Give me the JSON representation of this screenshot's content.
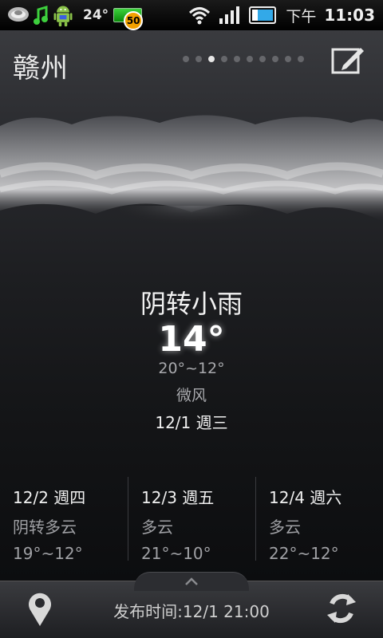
{
  "status_bar": {
    "temperature": "24°",
    "battery_badge": "50",
    "time_period": "下午",
    "time": "11:03",
    "icons": [
      "weather-clouds-icon",
      "music-note-icon",
      "android-icon",
      "battery-icon",
      "wifi-icon",
      "signal-icon",
      "battery-level-icon"
    ]
  },
  "header": {
    "city": "赣州",
    "page_count": 10,
    "active_page": 3,
    "edit_icon": "edit-icon"
  },
  "current": {
    "condition": "阴转小雨",
    "temperature": "14°",
    "range": "20°~12°",
    "wind": "微风",
    "date": "12/1 週三"
  },
  "forecast": [
    {
      "date": "12/2 週四",
      "condition": "阴转多云",
      "range": "19°~12°"
    },
    {
      "date": "12/3 週五",
      "condition": "多云",
      "range": "21°~10°"
    },
    {
      "date": "12/4 週六",
      "condition": "多云",
      "range": "22°~12°"
    }
  ],
  "bottom_bar": {
    "publish_time": "发布时间:12/1 21:00",
    "location_icon": "location-pin-icon",
    "refresh_icon": "refresh-icon",
    "expand_icon": "chevron-up-icon"
  }
}
